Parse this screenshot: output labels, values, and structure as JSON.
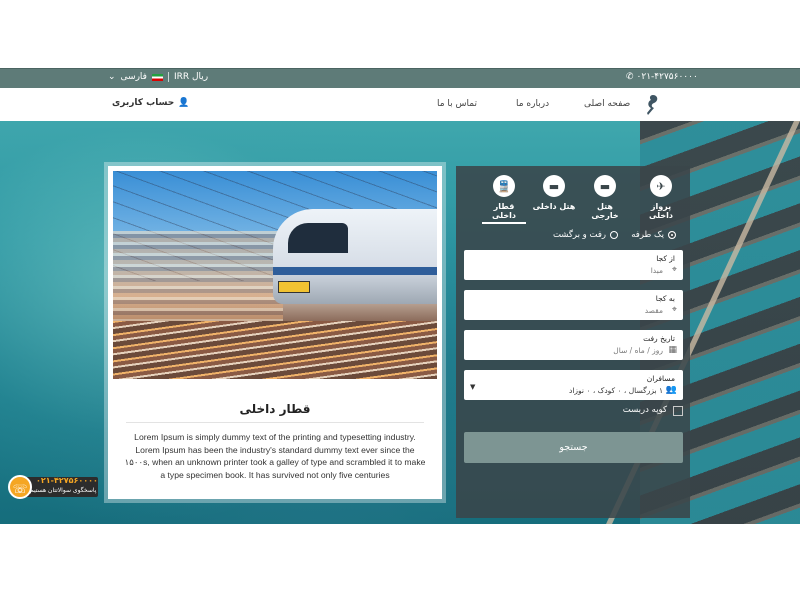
{
  "topbar": {
    "phone": "۰۲۱-۴۲۷۵۶۰۰۰۰",
    "currency": "IRR ریال",
    "language": "فارسی",
    "colors": {
      "bar": "#5e7b78"
    }
  },
  "nav": {
    "home": "صفحه اصلی",
    "about": "درباره ما",
    "contact": "تماس با ما",
    "account": "حساب کاربری"
  },
  "card": {
    "title": "قطار داخلی",
    "description": "Lorem Ipsum is simply dummy text of the printing and typesetting industry. Lorem Ipsum has been the industry's standard dummy text ever since the ۱۵۰۰s, when an unknown printer took a galley of type and scrambled it to make a type specimen book. It has survived not only five centuries"
  },
  "search": {
    "tabs": [
      {
        "label": "پرواز داخلی",
        "icon": "airplane-icon"
      },
      {
        "label": "هتل خارجی",
        "icon": "bed-icon"
      },
      {
        "label": "هتل داخلی",
        "icon": "bed-icon"
      },
      {
        "label": "قطار داخلی",
        "icon": "train-icon",
        "active": true
      }
    ],
    "trip_oneway": "یک طرفه",
    "trip_roundtrip": "رفت و برگشت",
    "from_label": "از کجا",
    "from_placeholder": "مبدا",
    "to_label": "به کجا",
    "to_placeholder": "مقصد",
    "date_label": "تاریخ رفت",
    "date_placeholder": "روز / ماه / سال",
    "passengers_label": "مسافران",
    "passengers_value": "۱ بزرگسال ، ۰ کودک ، ۰ نوزاد",
    "coupe_label": "کوپه دربست",
    "button": "جستجو"
  },
  "support": {
    "phone": "۰۲۱-۴۲۷۵۶۰۰۰۰",
    "caption": "پاسخگوی سوالاتتان هستیم"
  }
}
